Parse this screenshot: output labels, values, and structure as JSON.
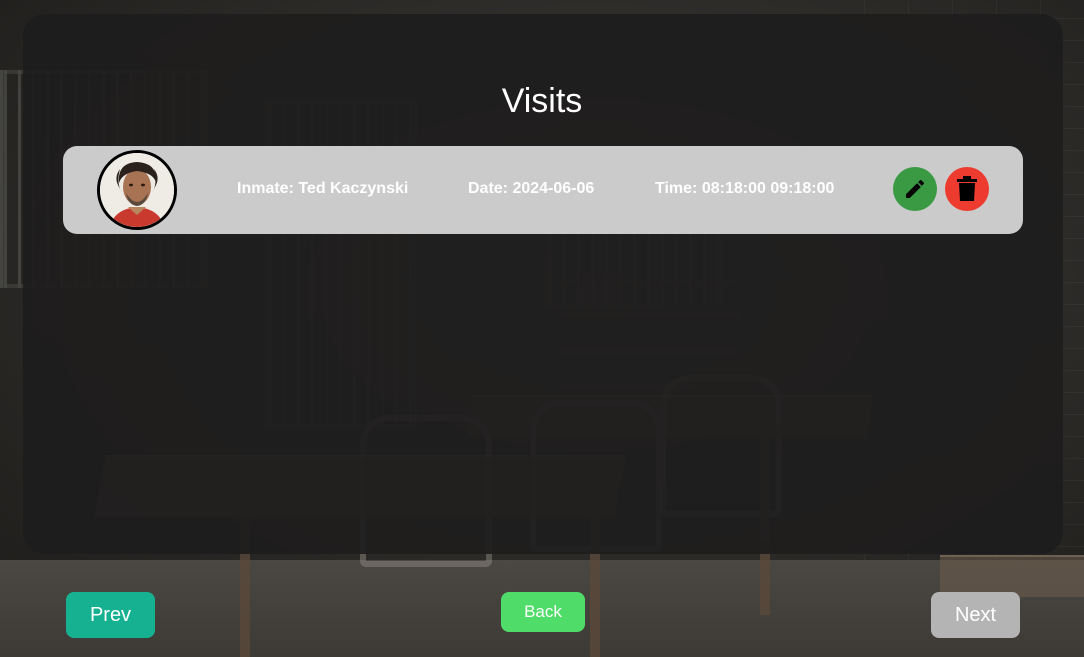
{
  "page": {
    "title": "Visits"
  },
  "visits": [
    {
      "inmate": "Inmate: Ted Kaczynski",
      "date": "Date: 2024-06-06",
      "time": "Time: 08:18:00 09:18:00",
      "avatar_icon": "inmate-photo",
      "edit_icon": "pencil-icon",
      "delete_icon": "trash-icon"
    }
  ],
  "nav": {
    "prev_label": "Prev",
    "back_label": "Back",
    "next_label": "Next"
  },
  "colors": {
    "prev": "#16b190",
    "back": "#4fdc68",
    "next": "#b4b4b4",
    "edit": "#3a9a44",
    "delete": "#ee3b2f",
    "card": "#cbcbcb"
  }
}
